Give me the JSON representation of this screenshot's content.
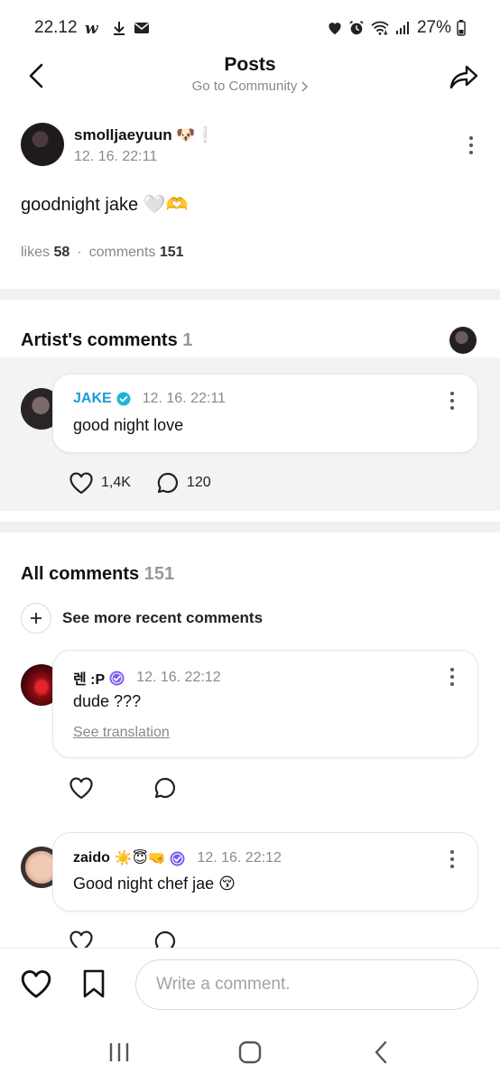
{
  "status_bar": {
    "time": "22.12",
    "battery": "27%",
    "icons_left": [
      "w-icon",
      "download-icon",
      "mail-icon"
    ],
    "icons_right": [
      "heart-icon",
      "alarm-icon",
      "wifi-icon",
      "signal-icon",
      "battery-icon"
    ]
  },
  "header": {
    "title": "Posts",
    "subtitle": "Go to Community"
  },
  "post": {
    "author": "smolljaeyuun",
    "author_emoji": "🐶❕",
    "time": "12. 16. 22:11",
    "text": "goodnight jake 🤍🫶",
    "likes_label": "likes",
    "likes": "58",
    "comments_label": "comments",
    "comments": "151"
  },
  "artist_comments": {
    "title": "Artist's comments",
    "count": "1",
    "comment": {
      "name": "JAKE",
      "time": "12. 16. 22:11",
      "text": "good night love",
      "likes": "1,4K",
      "replies": "120"
    }
  },
  "all_comments": {
    "title": "All comments",
    "count": "151",
    "see_more": "See more recent comments",
    "items": [
      {
        "name": "렌 :P",
        "time": "12. 16. 22:12",
        "text": "dude ???",
        "see_translation": "See translation"
      },
      {
        "name": "zaido",
        "name_emoji": "☀️😇🤜",
        "time": "12. 16. 22:12",
        "text": "Good night chef jae 😚"
      }
    ]
  },
  "composer": {
    "placeholder": "Write a comment."
  },
  "colors": {
    "verified_blue": "#1fb3d6",
    "verified_purple": "#7c5cf0",
    "artist_name": "#1a9ad6",
    "section_bg": "#f2f3f5"
  }
}
